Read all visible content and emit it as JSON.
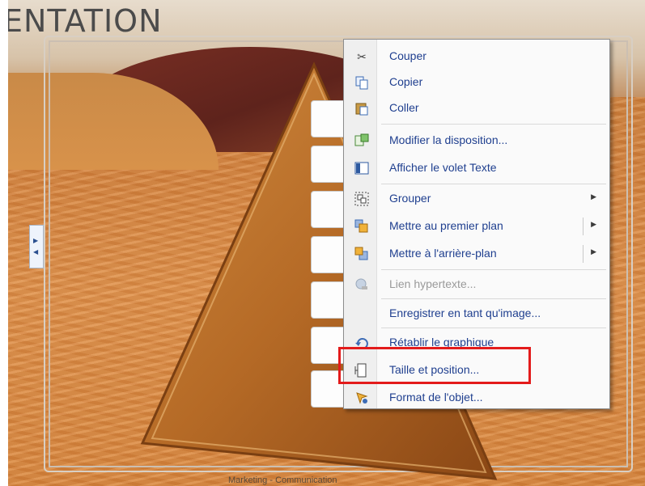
{
  "slide": {
    "title_fragment": "ENTATION",
    "footer_text": "Marketing - Communication"
  },
  "context_menu": {
    "items": [
      {
        "label": "Couper",
        "icon": "scissors-icon",
        "enabled": true
      },
      {
        "label": "Copier",
        "icon": "copy-icon",
        "enabled": true
      },
      {
        "label": "Coller",
        "icon": "paste-icon",
        "enabled": true
      },
      {
        "label": "Modifier la disposition...",
        "icon": "layout-icon",
        "enabled": true
      },
      {
        "label": "Afficher le volet Texte",
        "icon": "text-pane-icon",
        "enabled": true
      },
      {
        "label": "Grouper",
        "icon": "group-icon",
        "enabled": true,
        "submenu": true
      },
      {
        "label": "Mettre au premier plan",
        "icon": "bring-front-icon",
        "enabled": true,
        "submenu": true
      },
      {
        "label": "Mettre à l'arrière-plan",
        "icon": "send-back-icon",
        "enabled": true,
        "submenu": true
      },
      {
        "label": "Lien hypertexte...",
        "icon": "hyperlink-icon",
        "enabled": false
      },
      {
        "label": "Enregistrer en tant qu'image...",
        "icon": "",
        "enabled": true
      },
      {
        "label": "Rétablir le graphique",
        "icon": "reset-graphic-icon",
        "enabled": true
      },
      {
        "label": "Taille et position...",
        "icon": "size-position-icon",
        "enabled": true,
        "highlighted": true
      },
      {
        "label": "Format de l'objet...",
        "icon": "format-object-icon",
        "enabled": true
      }
    ]
  },
  "colors": {
    "menu_text": "#1f3f8f",
    "disabled_text": "#9a9a9a",
    "highlight_border": "#e31b1b",
    "sand": "#d5843f",
    "pyramid": "#b8702c"
  }
}
